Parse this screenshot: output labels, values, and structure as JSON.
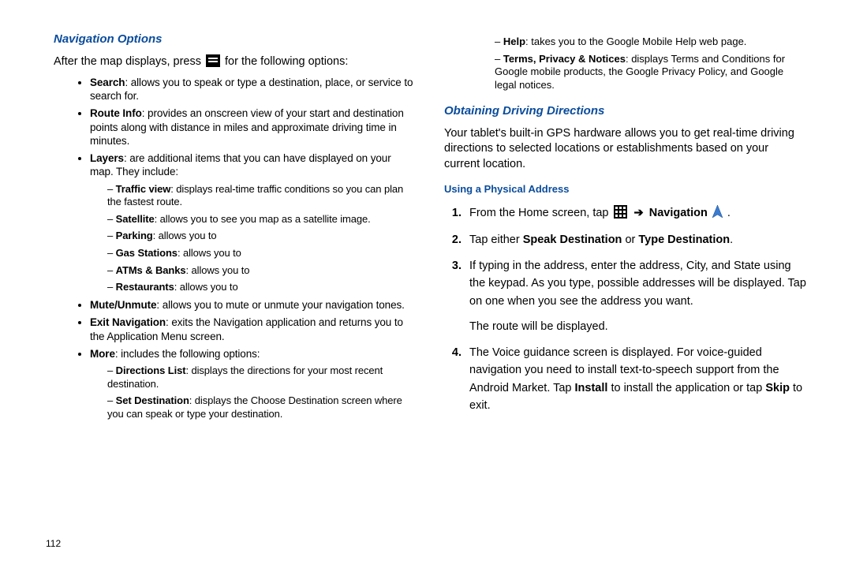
{
  "page_number": "112",
  "left": {
    "heading": "Navigation Options",
    "intro_pre": "After the map displays, press ",
    "intro_post": " for the following options:",
    "items": [
      {
        "term": "Search",
        "desc": ": allows you to speak or type a destination, place, or service to search for."
      },
      {
        "term": "Route Info",
        "desc": ": provides an onscreen view of your start and destination points along with distance in miles and approximate driving time in minutes."
      },
      {
        "term": "Layers",
        "desc": ": are additional items that you can have displayed on your map. They include:"
      },
      {
        "term": "Mute/Unmute",
        "desc": ": allows you to mute or unmute your navigation tones."
      },
      {
        "term": "Exit Navigation",
        "desc": ": exits the Navigation application and returns you to the Application Menu screen."
      },
      {
        "term": "More",
        "desc": ": includes the following options:"
      }
    ],
    "layers": [
      {
        "term": "Traffic view",
        "desc": ": displays real-time traffic conditions so you can plan the fastest route."
      },
      {
        "term": "Satellite",
        "desc": ": allows you to see you map as a satellite image."
      },
      {
        "term": "Parking",
        "desc": ": allows you to"
      },
      {
        "term": "Gas Stations",
        "desc": ": allows you to"
      },
      {
        "term": "ATMs & Banks",
        "desc": ": allows you to"
      },
      {
        "term": "Restaurants",
        "desc": ": allows you to"
      }
    ],
    "more": [
      {
        "term": "Directions List",
        "desc": ": displays the directions for your most recent destination."
      },
      {
        "term": "Set Destination",
        "desc": ": displays the Choose Destination screen where you can speak or type your destination."
      }
    ]
  },
  "right": {
    "more_cont": [
      {
        "term": "Help",
        "desc": ": takes you to the Google Mobile Help web page."
      },
      {
        "term": "Terms, Privacy & Notices",
        "desc": ": displays Terms and Conditions for Google mobile products, the Google Privacy Policy, and Google legal notices."
      }
    ],
    "heading": "Obtaining Driving Directions",
    "intro": "Your tablet's built-in GPS hardware allows you to get real-time driving directions to selected locations or establishments based on your current location.",
    "subhead": "Using a Physical Address",
    "steps": [
      {
        "pre": "From the Home screen, tap ",
        "arrow": "➔",
        "nav": "Navigation",
        "post": " ."
      },
      {
        "pre": "Tap either ",
        "b1": "Speak Destination",
        "mid": " or ",
        "b2": "Type Destination",
        "post": "."
      },
      {
        "text": "If typing in the address, enter the address, City, and State using the keypad. As you type, possible addresses will be displayed. Tap on one when you see the address you want.",
        "text2": "The route will be displayed."
      },
      {
        "pre": "The Voice guidance screen is displayed. For voice-guided navigation you need to install text-to-speech support from the Android Market. Tap ",
        "b1": "Install",
        "mid": " to install the application or tap ",
        "b2": "Skip",
        "post": " to exit."
      }
    ]
  }
}
